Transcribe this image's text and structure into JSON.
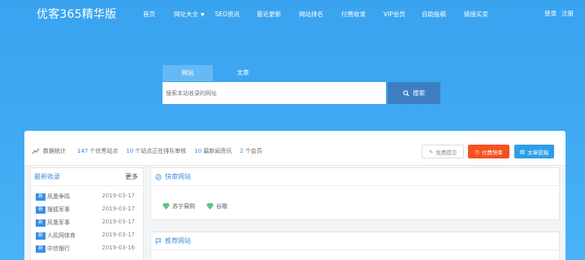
{
  "nav": {
    "logo": "优客365精华版",
    "items": [
      {
        "label": "首页"
      },
      {
        "label": "网址大全",
        "dropdown": true
      },
      {
        "label": "SEO资讯"
      },
      {
        "label": "最近更新"
      },
      {
        "label": "网站排名"
      },
      {
        "label": "付费收录"
      },
      {
        "label": "VIP会员"
      },
      {
        "label": "自助投稿"
      },
      {
        "label": "链接买卖"
      }
    ],
    "login": "登录",
    "register": "注册"
  },
  "search": {
    "tabs": [
      "网站",
      "文章"
    ],
    "active_tab": 0,
    "placeholder": "搜索本站收录的网址",
    "button_label": "搜索"
  },
  "stats": {
    "label": "数据统计",
    "sites_count": "147",
    "sites_label": "个优秀站点",
    "pending_count": "10",
    "pending_label": "个站点正在排队审核",
    "articles_count": "10",
    "articles_label": "篇新闻资讯",
    "members_count": "2",
    "members_label": "个会员",
    "btn_free": "免费提交",
    "btn_paid": "付费快审",
    "btn_post": "文章投稿"
  },
  "latest": {
    "title": "最新收录",
    "more": "更多",
    "badge": "新",
    "items": [
      {
        "name": "凤凰争鸣",
        "date": "2019-03-17"
      },
      {
        "name": "搜狐军事",
        "date": "2019-03-17"
      },
      {
        "name": "凤凰军事",
        "date": "2019-03-17"
      },
      {
        "name": "人民网体育",
        "date": "2019-03-17"
      },
      {
        "name": "中信银行",
        "date": "2019-03-16"
      }
    ]
  },
  "quick": {
    "title": "快审网站",
    "links": [
      "苏宁易购",
      "谷歌"
    ]
  },
  "recommended": {
    "title": "推荐网站"
  },
  "colors": {
    "accent": "#3a8ee6",
    "paid": "#f4511e",
    "search_button": "#3e7ec0",
    "diamond": "#5cc58a"
  }
}
